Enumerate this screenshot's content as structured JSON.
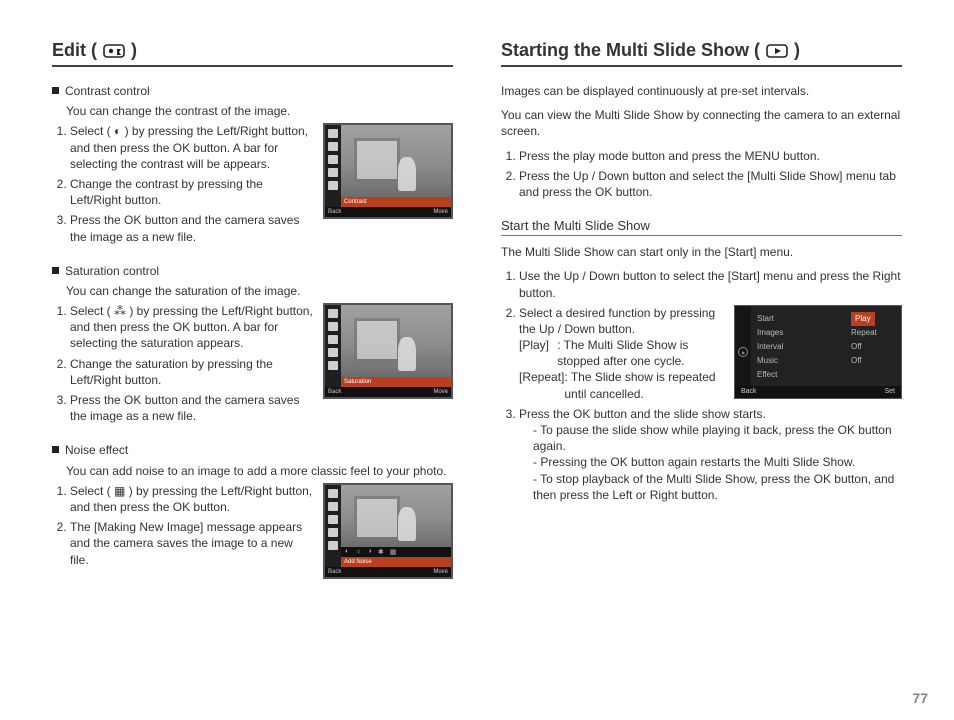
{
  "page_number": "77",
  "left": {
    "heading": "Edit (",
    "heading_close": ")",
    "contrast": {
      "title": "Contrast control",
      "desc": "You can change the contrast of the image.",
      "steps": [
        "Select ( ◐ ) by pressing the Left/Right button, and then press the OK button. A bar for selecting the contrast will be appears.",
        "Change the contrast by pressing the Left/Right button.",
        "Press the OK button and the camera saves the image as a new file."
      ],
      "fig_label": "Contrast",
      "fig_back": "Back",
      "fig_move": "Move"
    },
    "saturation": {
      "title": "Saturation control",
      "desc": "You can change the saturation of the image.",
      "steps": [
        "Select ( ⁂ ) by pressing the Left/Right button, and then press the OK button. A bar for selecting the saturation appears.",
        "Change the saturation by pressing the Left/Right button.",
        "Press the OK button and the camera saves the image as a new file."
      ],
      "fig_label": "Saturation",
      "fig_back": "Back",
      "fig_move": "Move"
    },
    "noise": {
      "title": "Noise effect",
      "desc": "You can add noise to an image to add a more classic feel to your photo.",
      "steps": [
        "Select ( ▦ ) by pressing the Left/Right button, and then press the OK button.",
        "The [Making New Image] message appears and the camera saves the image to a new file."
      ],
      "fig_label": "Add Noise",
      "fig_back": "Back",
      "fig_move": "Move"
    }
  },
  "right": {
    "heading": "Starting the Multi Slide Show (",
    "heading_close": ")",
    "intro1": "Images can be displayed continuously at pre-set intervals.",
    "intro2": "You can view the Multi Slide Show by connecting the camera to an external screen.",
    "top_steps": [
      "Press the play mode button and press the MENU button.",
      "Press the Up / Down button and select the [Multi Slide Show] menu tab and press the OK button."
    ],
    "sub_heading": "Start the Multi Slide Show",
    "sub_intro": "The Multi Slide Show can start only in the [Start] menu.",
    "sub_steps": {
      "s1": "Use the Up / Down button  to select the [Start] menu and press the Right button.",
      "s2_lead": "Select a desired function by pressing the Up / Down button.",
      "s2_play_k": "[Play]",
      "s2_play_v": ": The Multi Slide Show is stopped after one cycle.",
      "s2_repeat_k": "[Repeat]",
      "s2_repeat_v": ": The Slide show is repeated until cancelled.",
      "s3_lead": "Press the OK button and the slide show starts.",
      "s3_dashes": [
        "To pause the slide show while playing it back, press the OK button again.",
        "Pressing the OK button again restarts the Multi Slide Show.",
        "To stop playback of the Multi Slide Show, press the OK button, and then press the Left or Right button."
      ]
    },
    "menu": {
      "labels": [
        "Start",
        "Images",
        "Interval",
        "Music",
        "Effect"
      ],
      "values": [
        "Play",
        "Repeat",
        "",
        "Off",
        "Off"
      ],
      "back": "Back",
      "set": "Set"
    }
  }
}
